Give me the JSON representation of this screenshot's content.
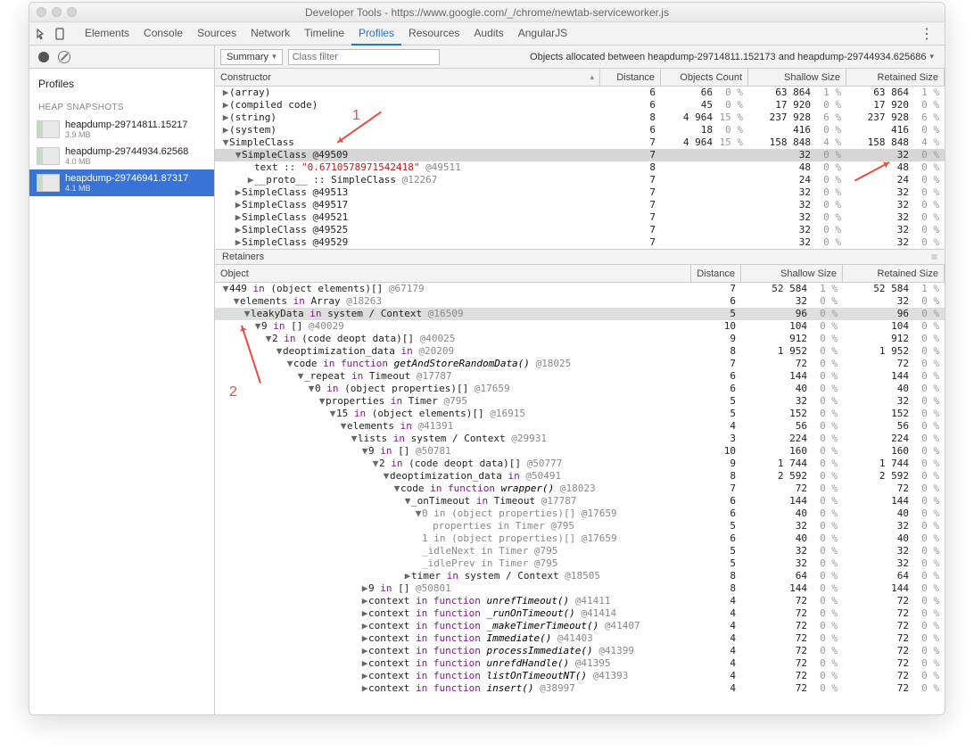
{
  "window": {
    "title": "Developer Tools - https://www.google.com/_/chrome/newtab-serviceworker.js"
  },
  "toolbar": {
    "tabs": [
      "Elements",
      "Console",
      "Sources",
      "Network",
      "Timeline",
      "Profiles",
      "Resources",
      "Audits",
      "AngularJS"
    ],
    "active": "Profiles"
  },
  "subbar": {
    "summary": "Summary",
    "filterPlaceholder": "Class filter",
    "comparison": "Objects allocated between heapdump-29714811.152173 and heapdump-29744934.625686"
  },
  "sidebar": {
    "title": "Profiles",
    "heading": "HEAP SNAPSHOTS",
    "snaps": [
      {
        "name": "heapdump-29714811.15217",
        "size": "3.9 MB"
      },
      {
        "name": "heapdump-29744934.62568",
        "size": "4.0 MB"
      },
      {
        "name": "heapdump-29746941.87317",
        "size": "4.1 MB"
      }
    ],
    "selected": 2
  },
  "constructors": {
    "headers": [
      "Constructor",
      "Distance",
      "Objects Count",
      "Shallow Size",
      "Retained Size"
    ],
    "rows": [
      {
        "ind": 0,
        "disc": "▶",
        "label": "(array)",
        "dist": "6",
        "cnt": "66",
        "cntp": "0 %",
        "ss": "63 864",
        "ssp": "1 %",
        "rs": "63 864",
        "rsp": "1 %"
      },
      {
        "ind": 0,
        "disc": "▶",
        "label": "(compiled code)",
        "dist": "6",
        "cnt": "45",
        "cntp": "0 %",
        "ss": "17 920",
        "ssp": "0 %",
        "rs": "17 920",
        "rsp": "0 %"
      },
      {
        "ind": 0,
        "disc": "▶",
        "label": "(string)",
        "dist": "8",
        "cnt": "4 964",
        "cntp": "15 %",
        "ss": "237 928",
        "ssp": "6 %",
        "rs": "237 928",
        "rsp": "6 %"
      },
      {
        "ind": 0,
        "disc": "▶",
        "label": "(system)",
        "dist": "6",
        "cnt": "18",
        "cntp": "0 %",
        "ss": "416",
        "ssp": "0 %",
        "rs": "416",
        "rsp": "0 %"
      },
      {
        "ind": 0,
        "disc": "▼",
        "label": "SimpleClass",
        "dist": "7",
        "cnt": "4 964",
        "cntp": "15 %",
        "ss": "158 848",
        "ssp": "4 %",
        "rs": "158 848",
        "rsp": "4 %"
      },
      {
        "ind": 1,
        "disc": "▼",
        "label": "SimpleClass @49509",
        "sel": true,
        "dist": "7",
        "cnt": "",
        "cntp": "",
        "ss": "32",
        "ssp": "0 %",
        "rs": "32",
        "rsp": "0 %"
      },
      {
        "ind": 2,
        "disc": "",
        "html": "text :: <span class='lit'>\"0.6710578971542418\"</span> <span class='dim'>@49511</span>",
        "dist": "8",
        "cnt": "",
        "cntp": "",
        "ss": "48",
        "ssp": "0 %",
        "rs": "48",
        "rsp": "0 %"
      },
      {
        "ind": 2,
        "disc": "▶",
        "html": "__proto__ :: SimpleClass <span class='dim'>@12267</span>",
        "dist": "7",
        "cnt": "",
        "cntp": "",
        "ss": "24",
        "ssp": "0 %",
        "rs": "24",
        "rsp": "0 %"
      },
      {
        "ind": 1,
        "disc": "▶",
        "label": "SimpleClass @49513",
        "dist": "7",
        "cnt": "",
        "cntp": "",
        "ss": "32",
        "ssp": "0 %",
        "rs": "32",
        "rsp": "0 %"
      },
      {
        "ind": 1,
        "disc": "▶",
        "label": "SimpleClass @49517",
        "dist": "7",
        "cnt": "",
        "cntp": "",
        "ss": "32",
        "ssp": "0 %",
        "rs": "32",
        "rsp": "0 %"
      },
      {
        "ind": 1,
        "disc": "▶",
        "label": "SimpleClass @49521",
        "dist": "7",
        "cnt": "",
        "cntp": "",
        "ss": "32",
        "ssp": "0 %",
        "rs": "32",
        "rsp": "0 %"
      },
      {
        "ind": 1,
        "disc": "▶",
        "label": "SimpleClass @49525",
        "dist": "7",
        "cnt": "",
        "cntp": "",
        "ss": "32",
        "ssp": "0 %",
        "rs": "32",
        "rsp": "0 %"
      },
      {
        "ind": 1,
        "disc": "▶",
        "label": "SimpleClass @49529",
        "dist": "7",
        "cnt": "",
        "cntp": "",
        "ss": "32",
        "ssp": "0 %",
        "rs": "32",
        "rsp": "0 %"
      }
    ]
  },
  "retainers": {
    "title": "Retainers",
    "headers": [
      "Object",
      "Distance",
      "Shallow Size",
      "Retained Size"
    ],
    "rows": [
      {
        "ind": 0,
        "disc": "▼",
        "html": "449 <span class='kw'>in</span> (object elements)[] <span class='dim'>@67179</span>",
        "dist": "7",
        "ss": "52 584",
        "ssp": "1 %",
        "rs": "52 584",
        "rsp": "1 %"
      },
      {
        "ind": 1,
        "disc": "▼",
        "html": "elements <span class='kw'>in</span> Array <span class='dim'>@18263</span>",
        "dist": "6",
        "ss": "32",
        "ssp": "0 %",
        "rs": "32",
        "rsp": "0 %"
      },
      {
        "ind": 2,
        "disc": "▼",
        "sel": true,
        "html": "leakyData <span class='kw'>in</span> system / Context <span class='dim'>@16509</span>",
        "dist": "5",
        "ss": "96",
        "ssp": "0 %",
        "rs": "96",
        "rsp": "0 %"
      },
      {
        "ind": 3,
        "disc": "▼",
        "html": "9 <span class='kw'>in</span> [] <span class='dim'>@40029</span>",
        "dist": "10",
        "ss": "104",
        "ssp": "0 %",
        "rs": "104",
        "rsp": "0 %"
      },
      {
        "ind": 4,
        "disc": "▼",
        "html": "2 <span class='kw'>in</span> (code deopt data)[] <span class='dim'>@40025</span>",
        "dist": "9",
        "ss": "912",
        "ssp": "0 %",
        "rs": "912",
        "rsp": "0 %"
      },
      {
        "ind": 5,
        "disc": "▼",
        "html": "deoptimization_data <span class='kw'>in</span> <span class='dim'>@20209</span>",
        "dist": "8",
        "ss": "1 952",
        "ssp": "0 %",
        "rs": "1 952",
        "rsp": "0 %"
      },
      {
        "ind": 6,
        "disc": "▼",
        "html": "code <span class='kw'>in</span> <span class='kw'>function</span> <span class='fn'>getAndStoreRandomData()</span> <span class='dim'>@18025</span>",
        "dist": "7",
        "ss": "72",
        "ssp": "0 %",
        "rs": "72",
        "rsp": "0 %"
      },
      {
        "ind": 7,
        "disc": "▼",
        "html": "_repeat <span class='kw'>in</span> Timeout <span class='dim'>@17787</span>",
        "dist": "6",
        "ss": "144",
        "ssp": "0 %",
        "rs": "144",
        "rsp": "0 %"
      },
      {
        "ind": 8,
        "disc": "▼",
        "html": "0 <span class='kw'>in</span> (object properties)[] <span class='dim'>@17659</span>",
        "dist": "6",
        "ss": "40",
        "ssp": "0 %",
        "rs": "40",
        "rsp": "0 %"
      },
      {
        "ind": 9,
        "disc": "▼",
        "html": "properties <span class='kw'>in</span> Timer <span class='dim'>@795</span>",
        "dist": "5",
        "ss": "32",
        "ssp": "0 %",
        "rs": "32",
        "rsp": "0 %"
      },
      {
        "ind": 10,
        "disc": "▼",
        "html": "15 <span class='kw'>in</span> (object elements)[] <span class='dim'>@16915</span>",
        "dist": "5",
        "ss": "152",
        "ssp": "0 %",
        "rs": "152",
        "rsp": "0 %"
      },
      {
        "ind": 11,
        "disc": "▼",
        "html": "elements <span class='kw'>in</span> <span class='dim'>@41391</span>",
        "dist": "4",
        "ss": "56",
        "ssp": "0 %",
        "rs": "56",
        "rsp": "0 %"
      },
      {
        "ind": 12,
        "disc": "▼",
        "html": "lists <span class='kw'>in</span> system / Context <span class='dim'>@29931</span>",
        "dist": "3",
        "ss": "224",
        "ssp": "0 %",
        "rs": "224",
        "rsp": "0 %"
      },
      {
        "ind": 13,
        "disc": "▼",
        "html": "9 <span class='kw'>in</span> [] <span class='dim'>@50781</span>",
        "dist": "10",
        "ss": "160",
        "ssp": "0 %",
        "rs": "160",
        "rsp": "0 %"
      },
      {
        "ind": 14,
        "disc": "▼",
        "html": "2 <span class='kw'>in</span> (code deopt data)[] <span class='dim'>@50777</span>",
        "dist": "9",
        "ss": "1 744",
        "ssp": "0 %",
        "rs": "1 744",
        "rsp": "0 %"
      },
      {
        "ind": 15,
        "disc": "▼",
        "html": "deoptimization_data <span class='kw'>in</span> <span class='dim'>@50491</span>",
        "dist": "8",
        "ss": "2 592",
        "ssp": "0 %",
        "rs": "2 592",
        "rsp": "0 %"
      },
      {
        "ind": 16,
        "disc": "▼",
        "html": "code <span class='kw'>in</span> <span class='kw'>function</span> <span class='fn'>wrapper()</span> <span class='dim'>@18023</span>",
        "dist": "7",
        "ss": "72",
        "ssp": "0 %",
        "rs": "72",
        "rsp": "0 %"
      },
      {
        "ind": 17,
        "disc": "▼",
        "html": "_onTimeout <span class='kw'>in</span> Timeout <span class='dim'>@17787</span>",
        "dist": "6",
        "ss": "144",
        "ssp": "0 %",
        "rs": "144",
        "rsp": "0 %"
      },
      {
        "ind": 18,
        "disc": "▼",
        "dim": true,
        "html": "0 <span>in</span> (object properties)[] <span>@17659</span>",
        "dist": "6",
        "ss": "40",
        "ssp": "0 %",
        "rs": "40",
        "rsp": "0 %"
      },
      {
        "ind": 19,
        "disc": "",
        "dim": true,
        "html": "properties <span>in</span> Timer <span>@795</span>",
        "dist": "5",
        "ss": "32",
        "ssp": "0 %",
        "rs": "32",
        "rsp": "0 %"
      },
      {
        "ind": 18,
        "disc": "",
        "dim": true,
        "html": "1 <span>in</span> (object properties)[] <span>@17659</span>",
        "dist": "6",
        "ss": "40",
        "ssp": "0 %",
        "rs": "40",
        "rsp": "0 %"
      },
      {
        "ind": 18,
        "disc": "",
        "dim": true,
        "html": "_idleNext <span>in</span> Timer <span>@795</span>",
        "dist": "5",
        "ss": "32",
        "ssp": "0 %",
        "rs": "32",
        "rsp": "0 %"
      },
      {
        "ind": 18,
        "disc": "",
        "dim": true,
        "html": "_idlePrev <span>in</span> Timer <span>@795</span>",
        "dist": "5",
        "ss": "32",
        "ssp": "0 %",
        "rs": "32",
        "rsp": "0 %"
      },
      {
        "ind": 17,
        "disc": "▶",
        "html": "timer <span class='kw'>in</span> system / Context <span class='dim'>@18505</span>",
        "dist": "8",
        "ss": "64",
        "ssp": "0 %",
        "rs": "64",
        "rsp": "0 %"
      },
      {
        "ind": 13,
        "disc": "▶",
        "html": "9 <span class='kw'>in</span> [] <span class='dim'>@50801</span>",
        "dist": "8",
        "ss": "144",
        "ssp": "0 %",
        "rs": "144",
        "rsp": "0 %"
      },
      {
        "ind": 13,
        "disc": "▶",
        "html": "context <span class='kw'>in</span> <span class='kw'>function</span> <span class='fn'>unrefTimeout()</span> <span class='dim'>@41411</span>",
        "dist": "4",
        "ss": "72",
        "ssp": "0 %",
        "rs": "72",
        "rsp": "0 %"
      },
      {
        "ind": 13,
        "disc": "▶",
        "html": "context <span class='kw'>in</span> <span class='kw'>function</span> <span class='fn'>_runOnTimeout()</span> <span class='dim'>@41414</span>",
        "dist": "4",
        "ss": "72",
        "ssp": "0 %",
        "rs": "72",
        "rsp": "0 %"
      },
      {
        "ind": 13,
        "disc": "▶",
        "html": "context <span class='kw'>in</span> <span class='kw'>function</span> <span class='fn'>_makeTimerTimeout()</span> <span class='dim'>@41407</span>",
        "dist": "4",
        "ss": "72",
        "ssp": "0 %",
        "rs": "72",
        "rsp": "0 %"
      },
      {
        "ind": 13,
        "disc": "▶",
        "html": "context <span class='kw'>in</span> <span class='kw'>function</span> <span class='fn'>Immediate()</span> <span class='dim'>@41403</span>",
        "dist": "4",
        "ss": "72",
        "ssp": "0 %",
        "rs": "72",
        "rsp": "0 %"
      },
      {
        "ind": 13,
        "disc": "▶",
        "html": "context <span class='kw'>in</span> <span class='kw'>function</span> <span class='fn'>processImmediate()</span> <span class='dim'>@41399</span>",
        "dist": "4",
        "ss": "72",
        "ssp": "0 %",
        "rs": "72",
        "rsp": "0 %"
      },
      {
        "ind": 13,
        "disc": "▶",
        "html": "context <span class='kw'>in</span> <span class='kw'>function</span> <span class='fn'>unrefdHandle()</span> <span class='dim'>@41395</span>",
        "dist": "4",
        "ss": "72",
        "ssp": "0 %",
        "rs": "72",
        "rsp": "0 %"
      },
      {
        "ind": 13,
        "disc": "▶",
        "html": "context <span class='kw'>in</span> <span class='kw'>function</span> <span class='fn'>listOnTimeoutNT()</span> <span class='dim'>@41393</span>",
        "dist": "4",
        "ss": "72",
        "ssp": "0 %",
        "rs": "72",
        "rsp": "0 %"
      },
      {
        "ind": 13,
        "disc": "▶",
        "html": "context <span class='kw'>in</span> <span class='kw'>function</span> <span class='fn'>insert()</span> <span class='dim'>@38997</span>",
        "dist": "4",
        "ss": "72",
        "ssp": "0 %",
        "rs": "72",
        "rsp": "0 %"
      }
    ]
  },
  "annotations": {
    "a1": "1",
    "a2": "2"
  }
}
